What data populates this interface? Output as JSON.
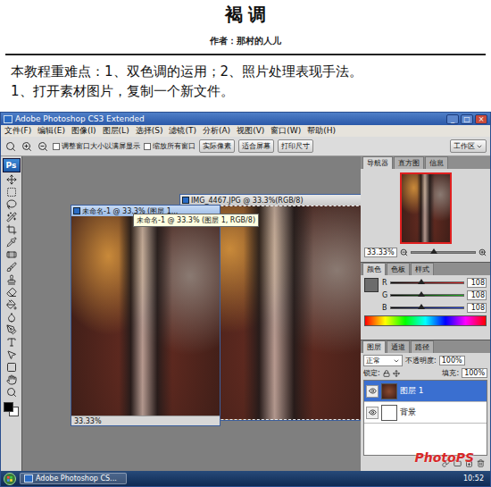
{
  "document": {
    "title": "褐 调",
    "author": "作者：那村的人儿",
    "intro": "本教程重难点：1、双色调的运用；2、照片处理表现手法。",
    "step": "1、打开素材图片，复制一个新文件。"
  },
  "window": {
    "title": "Adobe Photoshop CS3 Extended",
    "controls": [
      "_",
      "□",
      "×"
    ]
  },
  "menu": [
    "文件(F)",
    "编辑(E)",
    "图像(I)",
    "图层(L)",
    "选择(S)",
    "滤镜(T)",
    "分析(A)",
    "视图(V)",
    "窗口(W)",
    "帮助(H)"
  ],
  "options": {
    "checkboxes": [
      {
        "label": "调整窗口大小以满屏显示",
        "checked": false
      },
      {
        "label": "缩放所有窗口",
        "checked": false
      }
    ],
    "buttons": [
      "实际像素",
      "适合屏幕",
      "打印尺寸"
    ],
    "workspace": "工作区"
  },
  "toolbox": {
    "logo": "Ps"
  },
  "documents": [
    {
      "title": "IMG_4467.JPG @ 33.3%(RGB/8)",
      "active": false,
      "zoom": ""
    },
    {
      "title": "未命名-1 @ 33.3% (图层 1...",
      "active": true,
      "zoom": "33.33%"
    }
  ],
  "tooltip": "未命名-1 @ 33.3% (图层 1, RGB/8)",
  "navigator": {
    "tabs": [
      {
        "label": "导航器",
        "selected": true
      },
      {
        "label": "直方图",
        "selected": false
      },
      {
        "label": "信息",
        "selected": false
      }
    ],
    "zoom": "33.33%",
    "level": 0.35
  },
  "color": {
    "tabs": [
      {
        "label": "颜色",
        "selected": true
      },
      {
        "label": "色板",
        "selected": false
      },
      {
        "label": "样式",
        "selected": false
      }
    ],
    "channels": [
      {
        "name": "R",
        "value": "108",
        "level": 0.42,
        "color": "#e02020"
      },
      {
        "name": "G",
        "value": "108",
        "level": 0.42,
        "color": "#20b020"
      },
      {
        "name": "B",
        "value": "108",
        "level": 0.42,
        "color": "#2040e0"
      }
    ]
  },
  "layers": {
    "tabs": [
      {
        "label": "图层",
        "selected": true
      },
      {
        "label": "通道",
        "selected": false
      },
      {
        "label": "路径",
        "selected": false
      }
    ],
    "blend": "正常",
    "opacity_label": "不透明度:",
    "opacity": "100%",
    "lock_label": "锁定:",
    "fill_label": "填充:",
    "fill": "100%",
    "items": [
      {
        "name": "图层 1",
        "selected": true,
        "visible": true
      },
      {
        "name": "背景",
        "selected": false,
        "visible": true
      }
    ]
  },
  "taskbar": {
    "task": "Adobe Photoshop CS...",
    "time": "10:52"
  },
  "watermark": "PhotoPS"
}
